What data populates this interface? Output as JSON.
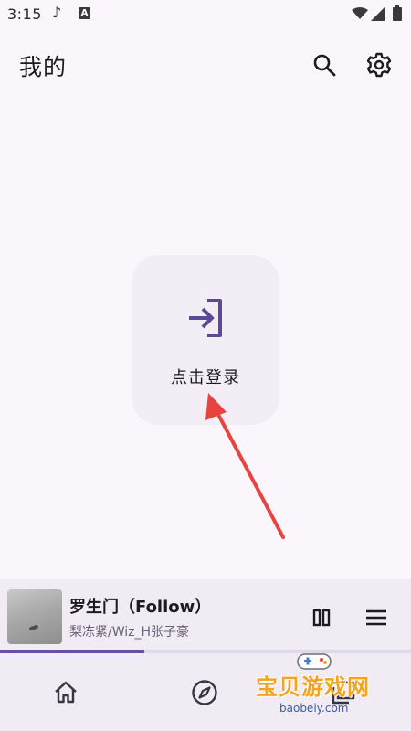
{
  "status_bar": {
    "time": "3:15",
    "icons": [
      "music-note-icon",
      "text-a-icon",
      "wifi-icon",
      "signal-icon",
      "battery-icon"
    ]
  },
  "header": {
    "title": "我的",
    "actions": [
      "search-icon",
      "settings-gear-icon"
    ]
  },
  "login": {
    "label": "点击登录",
    "icon": "login-arrow-icon",
    "accent_color": "#5b4a96"
  },
  "annotation": {
    "arrow_color": "#e8433e"
  },
  "player": {
    "title": "罗生门（Follow）",
    "artist": "梨冻紧/Wiz_H张子豪",
    "progress_fraction": 0.35,
    "controls": [
      "pause-icon",
      "queue-icon"
    ],
    "progress_color": "#6750a4"
  },
  "bottom_nav": {
    "items": [
      "home-icon",
      "explore-compass-icon",
      "library-icon"
    ]
  },
  "watermark": {
    "text": "宝贝游戏网",
    "url": "baobeiy.com"
  }
}
